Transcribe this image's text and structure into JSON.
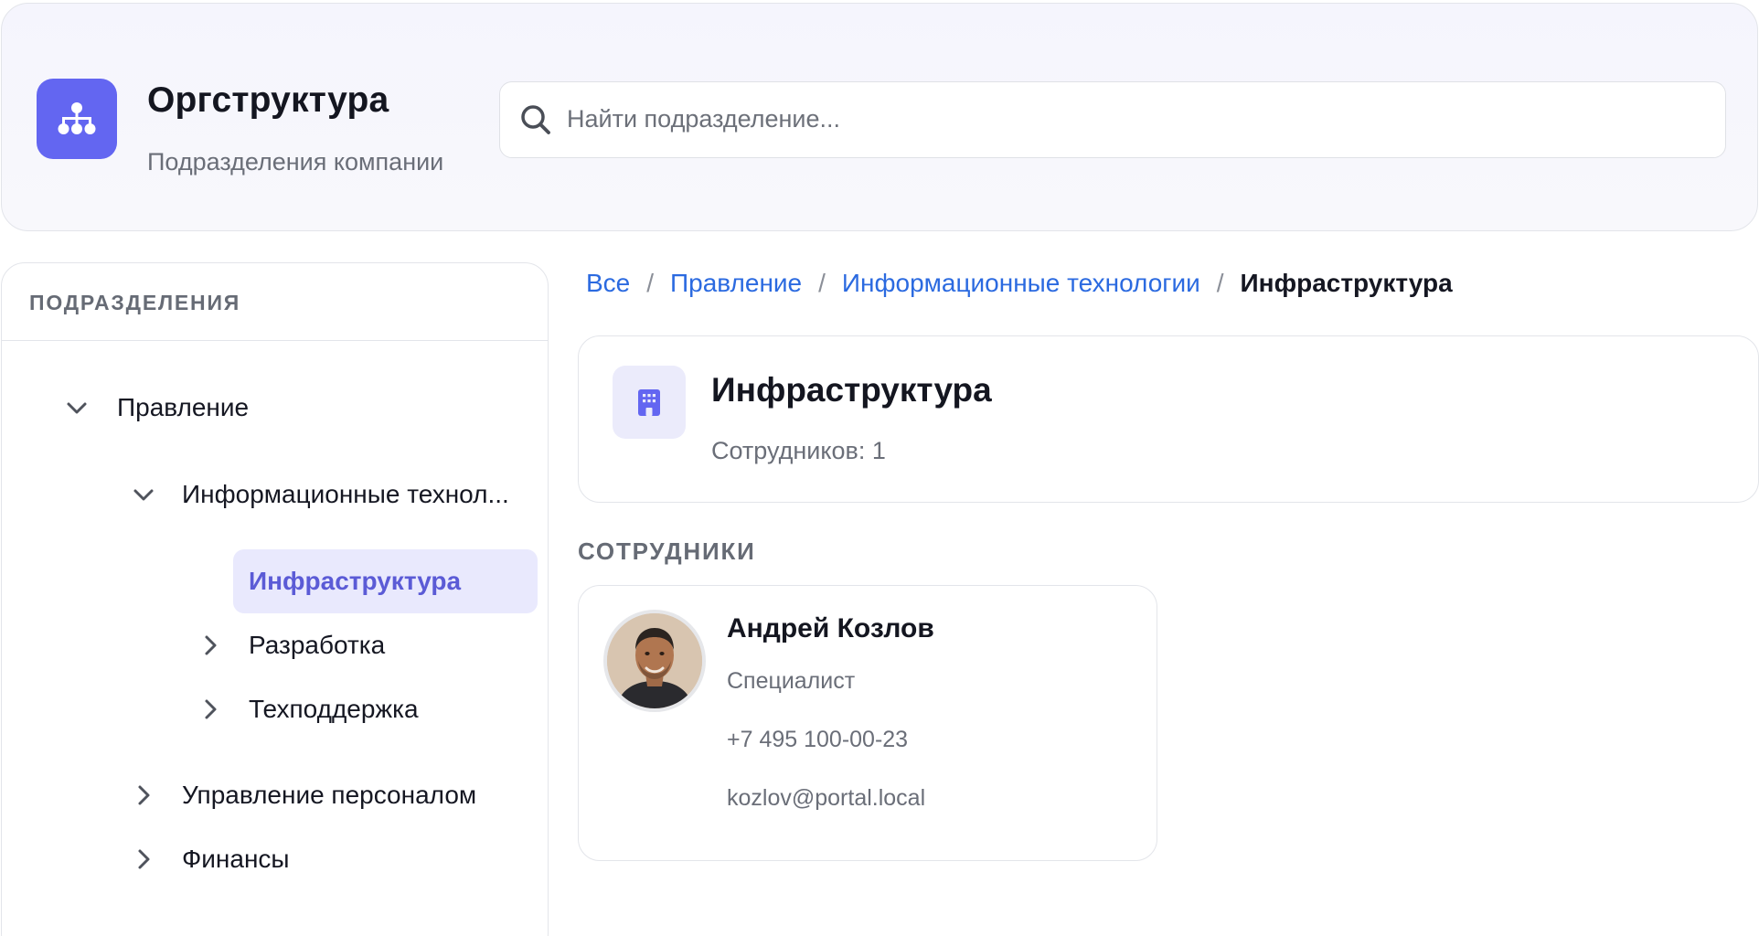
{
  "header": {
    "title": "Оргструктура",
    "subtitle": "Подразделения компании",
    "logo_icon": "org-chart-icon",
    "accent_color": "#6366f1"
  },
  "search": {
    "placeholder": "Найти подразделение...",
    "value": "",
    "icon": "search-icon"
  },
  "sidebar": {
    "heading": "ПОДРАЗДЕЛЕНИЯ",
    "tree": [
      {
        "label": "Правление",
        "expanded": true,
        "selected": false
      },
      {
        "label": "Информационные технол...",
        "expanded": true,
        "selected": false
      },
      {
        "label": "Инфраструктура",
        "expanded": false,
        "selected": true
      },
      {
        "label": "Разработка",
        "expanded": false,
        "selected": false
      },
      {
        "label": "Техподдержка",
        "expanded": false,
        "selected": false
      },
      {
        "label": "Управление персоналом",
        "expanded": false,
        "selected": false
      },
      {
        "label": "Финансы",
        "expanded": false,
        "selected": false
      }
    ]
  },
  "breadcrumb": {
    "items": [
      "Все",
      "Правление",
      "Информационные технологии"
    ],
    "current": "Инфраструктура",
    "separator": "/"
  },
  "department": {
    "title": "Инфраструктура",
    "employee_count": "Сотрудников: 1",
    "icon": "building-icon"
  },
  "employees_section": {
    "heading": "СОТРУДНИКИ",
    "items": [
      {
        "name": "Андрей Козлов",
        "role": "Специалист",
        "phone": "+7 495 100-00-23",
        "email": "kozlov@portal.local"
      }
    ]
  },
  "colors": {
    "link": "#2b6ae0",
    "selected_bg": "#e9e9fd",
    "selected_text": "#5b5bd6"
  }
}
